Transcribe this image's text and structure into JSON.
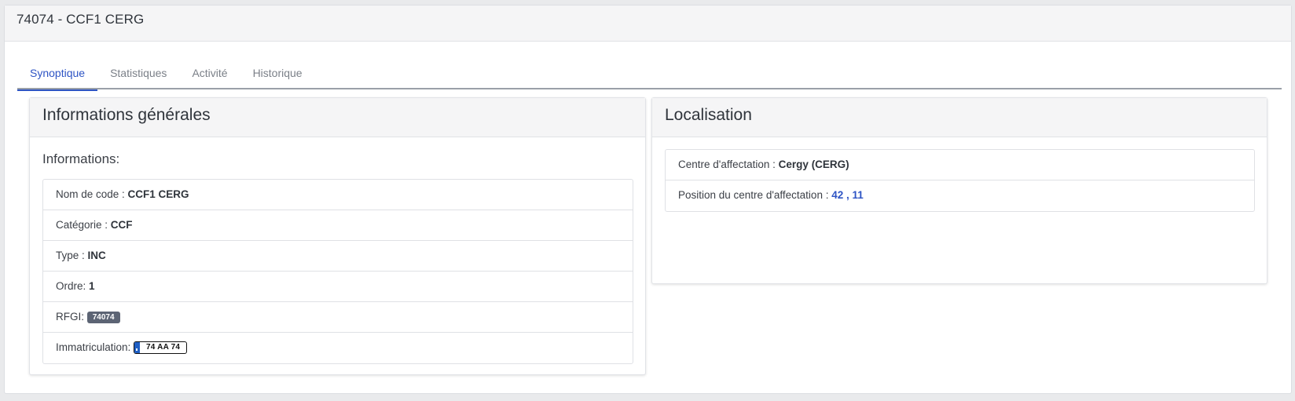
{
  "page": {
    "title": "74074 - CCF1 CERG"
  },
  "tabs": [
    {
      "label": "Synoptique"
    },
    {
      "label": "Statistiques"
    },
    {
      "label": "Activité"
    },
    {
      "label": "Historique"
    }
  ],
  "general": {
    "title": "Informations générales",
    "section_title": "Informations:",
    "rows": {
      "code_name": {
        "label": "Nom de code : ",
        "value": "CCF1 CERG"
      },
      "category": {
        "label": "Catégorie : ",
        "value": "CCF"
      },
      "type": {
        "label": "Type : ",
        "value": "INC"
      },
      "order": {
        "label": "Ordre: ",
        "value": "1"
      },
      "rfgi": {
        "label": "RFGI: ",
        "value": "74074"
      },
      "registration": {
        "label": "Immatriculation: ",
        "value": "74 AA 74"
      }
    }
  },
  "location": {
    "title": "Localisation",
    "rows": {
      "center": {
        "label": "Centre d'affectation : ",
        "value": "Cergy (CERG)"
      },
      "position": {
        "label": "Position du centre d'affectation : ",
        "value": "42 , 11"
      }
    }
  },
  "colors": {
    "accent": "#2e54c4",
    "badge": "#5c6474",
    "plate_eu": "#1f5fc4"
  }
}
